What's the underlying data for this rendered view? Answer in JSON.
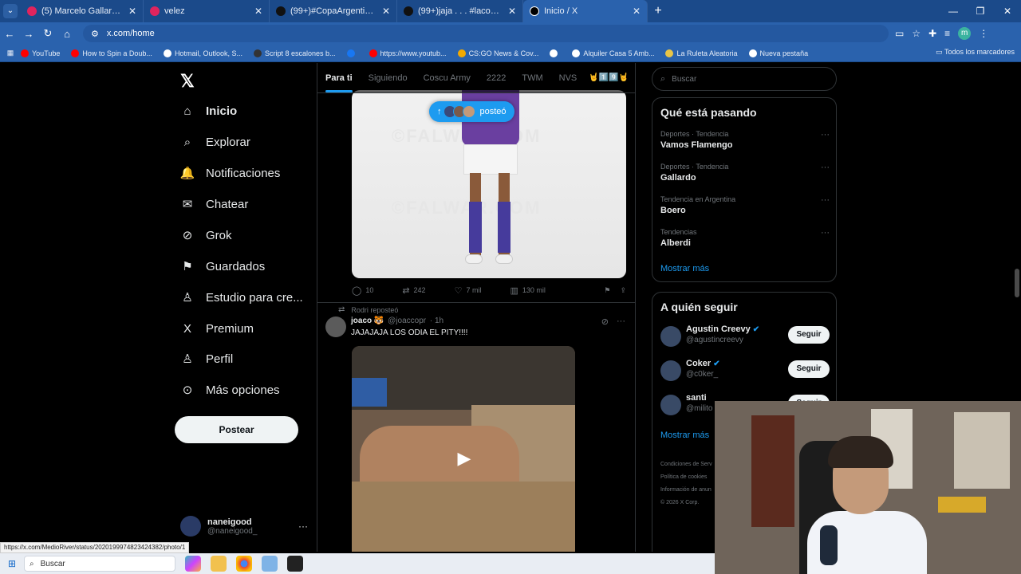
{
  "browser": {
    "tabs": [
      {
        "title": "(5) Marcelo Gallardo - Cierren l",
        "color": "#e0245e"
      },
      {
        "title": "velez",
        "color": "#e0245e"
      },
      {
        "title": "(99+)#CopaArgentina 2013 #Ju",
        "color": "#111111"
      },
      {
        "title": "(99+)jaja . . . #lacobra #lacobra",
        "color": "#111111"
      },
      {
        "title": "Inicio / X",
        "color": "#000000"
      }
    ],
    "new_tab": "+",
    "url": "x.com/home",
    "profile_initial": "m",
    "bookmarks": [
      {
        "label": "YouTube",
        "color": "#ff0000"
      },
      {
        "label": "How to Spin a Doub...",
        "color": "#ff0000"
      },
      {
        "label": "Hotmail, Outlook, S...",
        "color": "#ffffff"
      },
      {
        "label": "Script 8 escalones b...",
        "color": "#333333"
      },
      {
        "label": "",
        "color": "#1877f2"
      },
      {
        "label": "https://www.youtub...",
        "color": "#ff0000"
      },
      {
        "label": "CS:GO News & Cov...",
        "color": "#f2a900"
      },
      {
        "label": "",
        "color": "#ffffff"
      },
      {
        "label": "Alquiler Casa 5 Amb...",
        "color": "#ffffff"
      },
      {
        "label": "La Ruleta Aleatoria",
        "color": "#e8c547"
      },
      {
        "label": "Nueva pestaña",
        "color": "#ffffff"
      }
    ],
    "all_bookmarks": "Todos los marcadores"
  },
  "sidebar": {
    "items": [
      {
        "label": "Inicio",
        "icon": "⌂"
      },
      {
        "label": "Explorar",
        "icon": "⌕"
      },
      {
        "label": "Notificaciones",
        "icon": "🔔"
      },
      {
        "label": "Chatear",
        "icon": "✉"
      },
      {
        "label": "Grok",
        "icon": "⊘"
      },
      {
        "label": "Guardados",
        "icon": "⚑"
      },
      {
        "label": "Estudio para cre...",
        "icon": "♙"
      },
      {
        "label": "Premium",
        "icon": "X"
      },
      {
        "label": "Perfil",
        "icon": "♙"
      },
      {
        "label": "Más opciones",
        "icon": "⊙"
      }
    ],
    "post_button": "Postear",
    "account": {
      "name": "naneigood",
      "handle": "@naneigood_"
    }
  },
  "feed": {
    "tabs": [
      "Para ti",
      "Siguiendo",
      "Coscu Army",
      "2222",
      "TWM",
      "NVS"
    ],
    "tabs_emoji": "🤘1️⃣9️⃣🤘",
    "new_posts_pill": "posteó",
    "watermark": "©FALWAR.COM",
    "tweet1_actions": {
      "replies": "10",
      "reposts": "242",
      "likes": "7 mil",
      "views": "130 mil"
    },
    "tweet2": {
      "reposted_by": "Rodri reposteó",
      "name": "joaco 🐯",
      "handle": "@joaccopr",
      "time": "· 1h",
      "text": "JAJAJAJA LOS ODIA EL PITY!!!!"
    }
  },
  "right": {
    "search_placeholder": "Buscar",
    "trending_title": "Qué está pasando",
    "trends": [
      {
        "category": "Deportes · Tendencia",
        "topic": "Vamos Flamengo"
      },
      {
        "category": "Deportes · Tendencia",
        "topic": "Gallardo"
      },
      {
        "category": "Tendencia en Argentina",
        "topic": "Boero"
      },
      {
        "category": "Tendencias",
        "topic": "Alberdi"
      }
    ],
    "show_more": "Mostrar más",
    "follow_title": "A quién seguir",
    "follow": [
      {
        "name": "Agustin Creevy",
        "handle": "@agustincreevy",
        "verified": "✔",
        "button": "Seguir"
      },
      {
        "name": "Coker",
        "handle": "@c0ker_",
        "verified": "✔",
        "button": "Seguir"
      },
      {
        "name": "santi",
        "handle": "@milito",
        "verified": "",
        "button": "Seguir"
      }
    ],
    "footer": [
      "Condiciones de Serv",
      "Política de cookies",
      "Información de anun",
      "© 2026 X Corp."
    ]
  },
  "status_url": "https://x.com/MedioRiver/status/2020199974823424382/photo/1",
  "taskbar": {
    "search": "Buscar"
  }
}
